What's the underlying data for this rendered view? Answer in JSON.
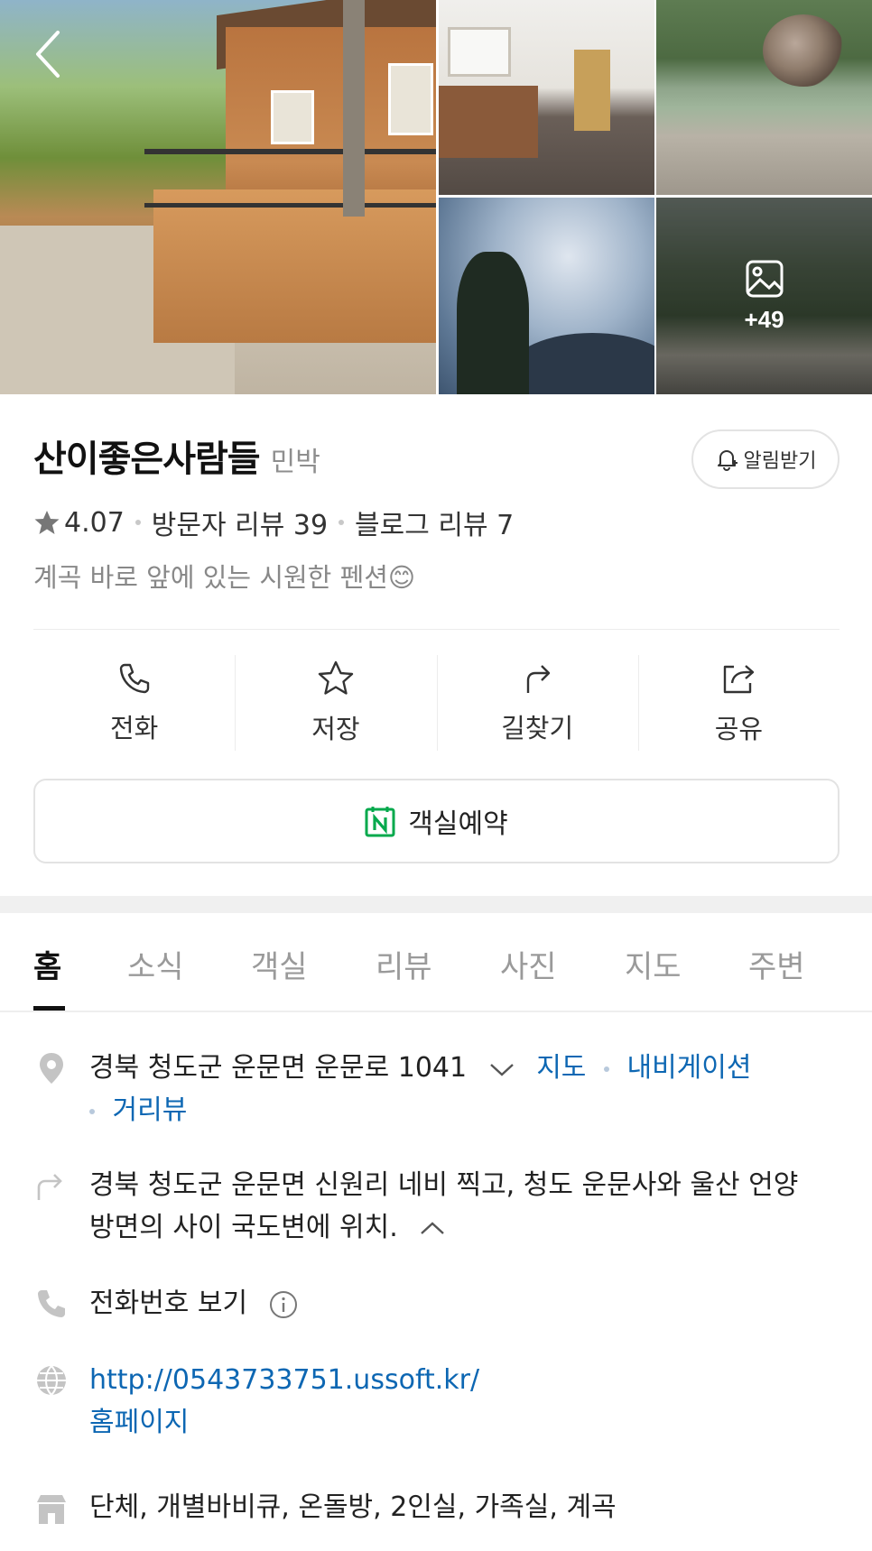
{
  "gallery": {
    "more_count": "+49"
  },
  "place": {
    "name": "산이좋은사람들",
    "category": "민박",
    "notify_label": "알림받기",
    "rating": "4.07",
    "visitor_reviews": "방문자 리뷰 39",
    "blog_reviews": "블로그 리뷰 7",
    "description": "계곡 바로 앞에 있는 시원한 펜션😊"
  },
  "actions": [
    {
      "label": "전화",
      "icon": "phone-icon"
    },
    {
      "label": "저장",
      "icon": "star-icon"
    },
    {
      "label": "길찾기",
      "icon": "directions-icon"
    },
    {
      "label": "공유",
      "icon": "share-icon"
    }
  ],
  "reserve": {
    "label": "객실예약"
  },
  "tabs": [
    "홈",
    "소식",
    "객실",
    "리뷰",
    "사진",
    "지도",
    "주변"
  ],
  "details": {
    "address": "경북 청도군 운문면 운문로 1041",
    "map_link": "지도",
    "navigation_link": "내비게이션",
    "street_view_link": "거리뷰",
    "directions_line1": "경북 청도군 운문면 신원리 네비 찍고, 청도 운문사와 울산 언양",
    "directions_line2": "방면의 사이 국도변에 위치.",
    "phone": "전화번호 보기",
    "website_url": "http://0543733751.ussoft.kr/",
    "website_label": "홈페이지",
    "amenities": "단체, 개별바비큐, 온돌방, 2인실, 가족실, 계곡"
  },
  "colors": {
    "link": "#0d67b3",
    "reserve_icon": "#03a94c",
    "active_tab": "#111111"
  }
}
